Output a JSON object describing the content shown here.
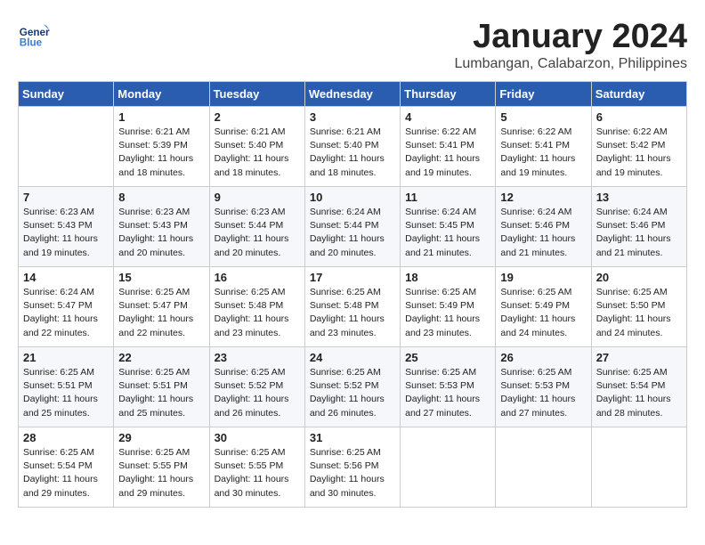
{
  "header": {
    "logo_general": "General",
    "logo_blue": "Blue",
    "month": "January 2024",
    "location": "Lumbangan, Calabarzon, Philippines"
  },
  "weekdays": [
    "Sunday",
    "Monday",
    "Tuesday",
    "Wednesday",
    "Thursday",
    "Friday",
    "Saturday"
  ],
  "weeks": [
    [
      {
        "day": "",
        "info": ""
      },
      {
        "day": "1",
        "info": "Sunrise: 6:21 AM\nSunset: 5:39 PM\nDaylight: 11 hours\nand 18 minutes."
      },
      {
        "day": "2",
        "info": "Sunrise: 6:21 AM\nSunset: 5:40 PM\nDaylight: 11 hours\nand 18 minutes."
      },
      {
        "day": "3",
        "info": "Sunrise: 6:21 AM\nSunset: 5:40 PM\nDaylight: 11 hours\nand 18 minutes."
      },
      {
        "day": "4",
        "info": "Sunrise: 6:22 AM\nSunset: 5:41 PM\nDaylight: 11 hours\nand 19 minutes."
      },
      {
        "day": "5",
        "info": "Sunrise: 6:22 AM\nSunset: 5:41 PM\nDaylight: 11 hours\nand 19 minutes."
      },
      {
        "day": "6",
        "info": "Sunrise: 6:22 AM\nSunset: 5:42 PM\nDaylight: 11 hours\nand 19 minutes."
      }
    ],
    [
      {
        "day": "7",
        "info": "Sunrise: 6:23 AM\nSunset: 5:43 PM\nDaylight: 11 hours\nand 19 minutes."
      },
      {
        "day": "8",
        "info": "Sunrise: 6:23 AM\nSunset: 5:43 PM\nDaylight: 11 hours\nand 20 minutes."
      },
      {
        "day": "9",
        "info": "Sunrise: 6:23 AM\nSunset: 5:44 PM\nDaylight: 11 hours\nand 20 minutes."
      },
      {
        "day": "10",
        "info": "Sunrise: 6:24 AM\nSunset: 5:44 PM\nDaylight: 11 hours\nand 20 minutes."
      },
      {
        "day": "11",
        "info": "Sunrise: 6:24 AM\nSunset: 5:45 PM\nDaylight: 11 hours\nand 21 minutes."
      },
      {
        "day": "12",
        "info": "Sunrise: 6:24 AM\nSunset: 5:46 PM\nDaylight: 11 hours\nand 21 minutes."
      },
      {
        "day": "13",
        "info": "Sunrise: 6:24 AM\nSunset: 5:46 PM\nDaylight: 11 hours\nand 21 minutes."
      }
    ],
    [
      {
        "day": "14",
        "info": "Sunrise: 6:24 AM\nSunset: 5:47 PM\nDaylight: 11 hours\nand 22 minutes."
      },
      {
        "day": "15",
        "info": "Sunrise: 6:25 AM\nSunset: 5:47 PM\nDaylight: 11 hours\nand 22 minutes."
      },
      {
        "day": "16",
        "info": "Sunrise: 6:25 AM\nSunset: 5:48 PM\nDaylight: 11 hours\nand 23 minutes."
      },
      {
        "day": "17",
        "info": "Sunrise: 6:25 AM\nSunset: 5:48 PM\nDaylight: 11 hours\nand 23 minutes."
      },
      {
        "day": "18",
        "info": "Sunrise: 6:25 AM\nSunset: 5:49 PM\nDaylight: 11 hours\nand 23 minutes."
      },
      {
        "day": "19",
        "info": "Sunrise: 6:25 AM\nSunset: 5:49 PM\nDaylight: 11 hours\nand 24 minutes."
      },
      {
        "day": "20",
        "info": "Sunrise: 6:25 AM\nSunset: 5:50 PM\nDaylight: 11 hours\nand 24 minutes."
      }
    ],
    [
      {
        "day": "21",
        "info": "Sunrise: 6:25 AM\nSunset: 5:51 PM\nDaylight: 11 hours\nand 25 minutes."
      },
      {
        "day": "22",
        "info": "Sunrise: 6:25 AM\nSunset: 5:51 PM\nDaylight: 11 hours\nand 25 minutes."
      },
      {
        "day": "23",
        "info": "Sunrise: 6:25 AM\nSunset: 5:52 PM\nDaylight: 11 hours\nand 26 minutes."
      },
      {
        "day": "24",
        "info": "Sunrise: 6:25 AM\nSunset: 5:52 PM\nDaylight: 11 hours\nand 26 minutes."
      },
      {
        "day": "25",
        "info": "Sunrise: 6:25 AM\nSunset: 5:53 PM\nDaylight: 11 hours\nand 27 minutes."
      },
      {
        "day": "26",
        "info": "Sunrise: 6:25 AM\nSunset: 5:53 PM\nDaylight: 11 hours\nand 27 minutes."
      },
      {
        "day": "27",
        "info": "Sunrise: 6:25 AM\nSunset: 5:54 PM\nDaylight: 11 hours\nand 28 minutes."
      }
    ],
    [
      {
        "day": "28",
        "info": "Sunrise: 6:25 AM\nSunset: 5:54 PM\nDaylight: 11 hours\nand 29 minutes."
      },
      {
        "day": "29",
        "info": "Sunrise: 6:25 AM\nSunset: 5:55 PM\nDaylight: 11 hours\nand 29 minutes."
      },
      {
        "day": "30",
        "info": "Sunrise: 6:25 AM\nSunset: 5:55 PM\nDaylight: 11 hours\nand 30 minutes."
      },
      {
        "day": "31",
        "info": "Sunrise: 6:25 AM\nSunset: 5:56 PM\nDaylight: 11 hours\nand 30 minutes."
      },
      {
        "day": "",
        "info": ""
      },
      {
        "day": "",
        "info": ""
      },
      {
        "day": "",
        "info": ""
      }
    ]
  ]
}
